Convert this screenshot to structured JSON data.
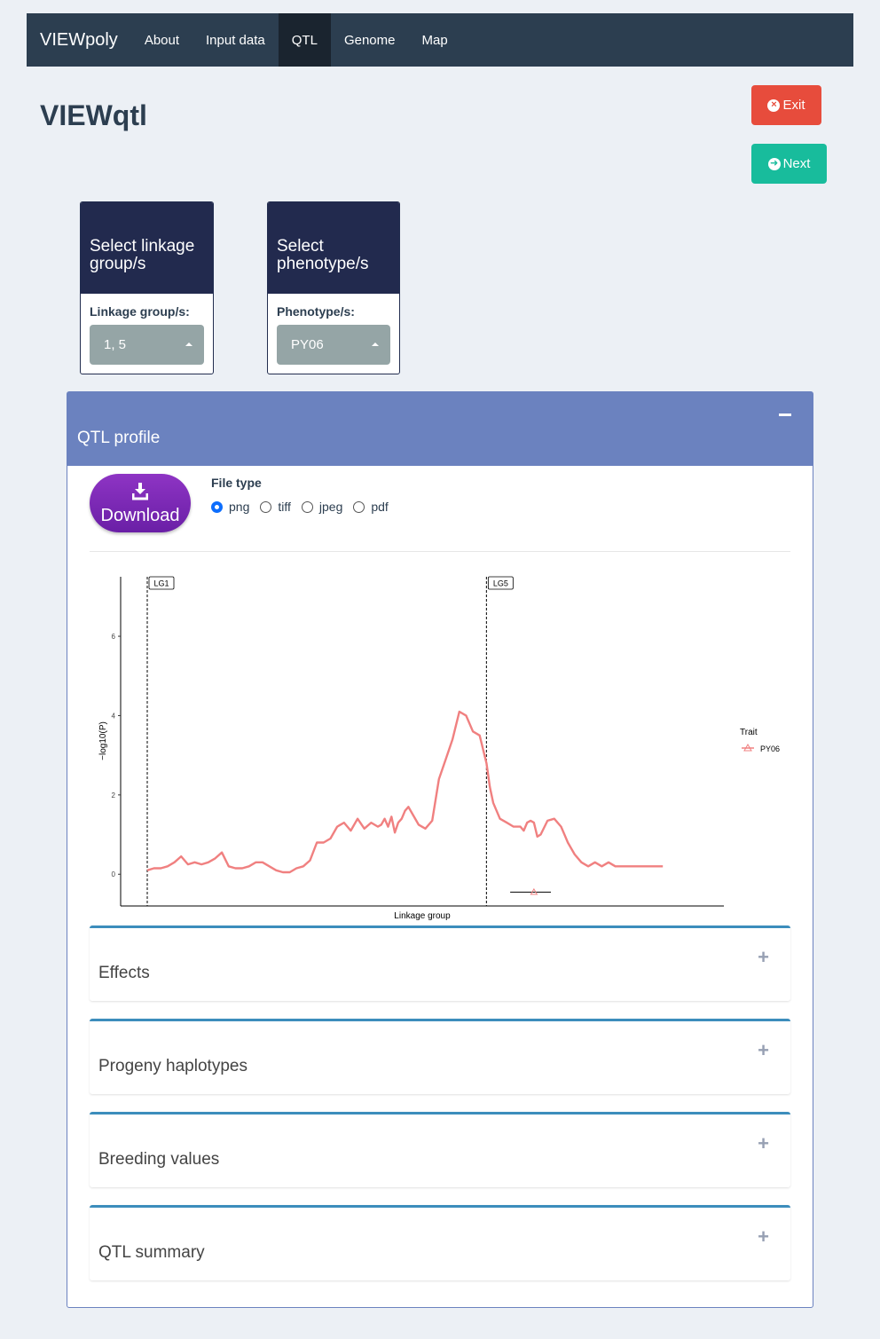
{
  "navbar": {
    "brand": "VIEWpoly",
    "items": [
      "About",
      "Input data",
      "QTL",
      "Genome",
      "Map"
    ],
    "active": "QTL"
  },
  "page": {
    "title": "VIEWqtl",
    "exit_label": "Exit",
    "next_label": "Next"
  },
  "linkage": {
    "header": "Select linkage group/s",
    "label": "Linkage group/s:",
    "value": "1, 5"
  },
  "phenotype": {
    "header": "Select phenotype/s",
    "label": "Phenotype/s:",
    "value": "PY06"
  },
  "qtl_profile": {
    "title": "QTL profile",
    "download_label": "Download",
    "file_type_label": "File type",
    "file_types": [
      "png",
      "tiff",
      "jpeg",
      "pdf"
    ],
    "selected_file_type": "png"
  },
  "chart_data": {
    "type": "line",
    "xlabel": "Linkage group",
    "ylabel": "−log10(P)",
    "ylim": [
      -0.8,
      7.5
    ],
    "yticks": [
      0,
      2,
      4,
      6
    ],
    "grid": false,
    "legend": {
      "title": "Trait",
      "placement": "right",
      "entries": [
        "PY06"
      ]
    },
    "linkage_groups": [
      {
        "label": "LG1",
        "start": 0,
        "end": 100
      },
      {
        "label": "LG5",
        "start": 100,
        "end": 152
      }
    ],
    "series": [
      {
        "name": "PY06",
        "color": "#f08080",
        "x": [
          0,
          2,
          4,
          6,
          8,
          10,
          12,
          14,
          16,
          18,
          20,
          22,
          24,
          26,
          28,
          30,
          32,
          34,
          36,
          38,
          40,
          42,
          44,
          46,
          48,
          50,
          52,
          54,
          56,
          58,
          60,
          62,
          64,
          66,
          68,
          69,
          70,
          71,
          72,
          73,
          74,
          75,
          76,
          77,
          78,
          80,
          82,
          84,
          86,
          88,
          90,
          92,
          94,
          96,
          98,
          100,
          101,
          102,
          104,
          106,
          108,
          110,
          111,
          112,
          113,
          114,
          115,
          116,
          118,
          120,
          122,
          124,
          126,
          128,
          130,
          132,
          134,
          136,
          138,
          140,
          142,
          144,
          146,
          148,
          150,
          152
        ],
        "y": [
          0.1,
          0.15,
          0.15,
          0.2,
          0.3,
          0.45,
          0.25,
          0.3,
          0.25,
          0.3,
          0.4,
          0.55,
          0.2,
          0.15,
          0.15,
          0.2,
          0.3,
          0.3,
          0.2,
          0.1,
          0.05,
          0.05,
          0.15,
          0.2,
          0.35,
          0.8,
          0.8,
          0.9,
          1.2,
          1.3,
          1.1,
          1.4,
          1.15,
          1.3,
          1.2,
          1.25,
          1.4,
          1.2,
          1.45,
          1.05,
          1.3,
          1.4,
          1.6,
          1.7,
          1.55,
          1.25,
          1.15,
          1.35,
          2.4,
          2.9,
          3.4,
          4.1,
          4.0,
          3.6,
          3.5,
          2.8,
          2.2,
          1.8,
          1.4,
          1.3,
          1.2,
          1.2,
          1.1,
          1.3,
          1.35,
          1.3,
          0.95,
          1.0,
          1.35,
          1.4,
          1.2,
          0.8,
          0.5,
          0.3,
          0.2,
          0.3,
          0.2,
          0.3,
          0.2,
          0.2,
          0.2,
          0.2,
          0.2,
          0.2,
          0.2,
          0.2
        ]
      }
    ],
    "qtl_marker": {
      "position": 114,
      "interval": [
        107,
        119
      ],
      "y": -0.45
    }
  },
  "sections": {
    "effects": "Effects",
    "progeny": "Progeny haplotypes",
    "breeding": "Breeding values",
    "summary": "QTL summary"
  }
}
